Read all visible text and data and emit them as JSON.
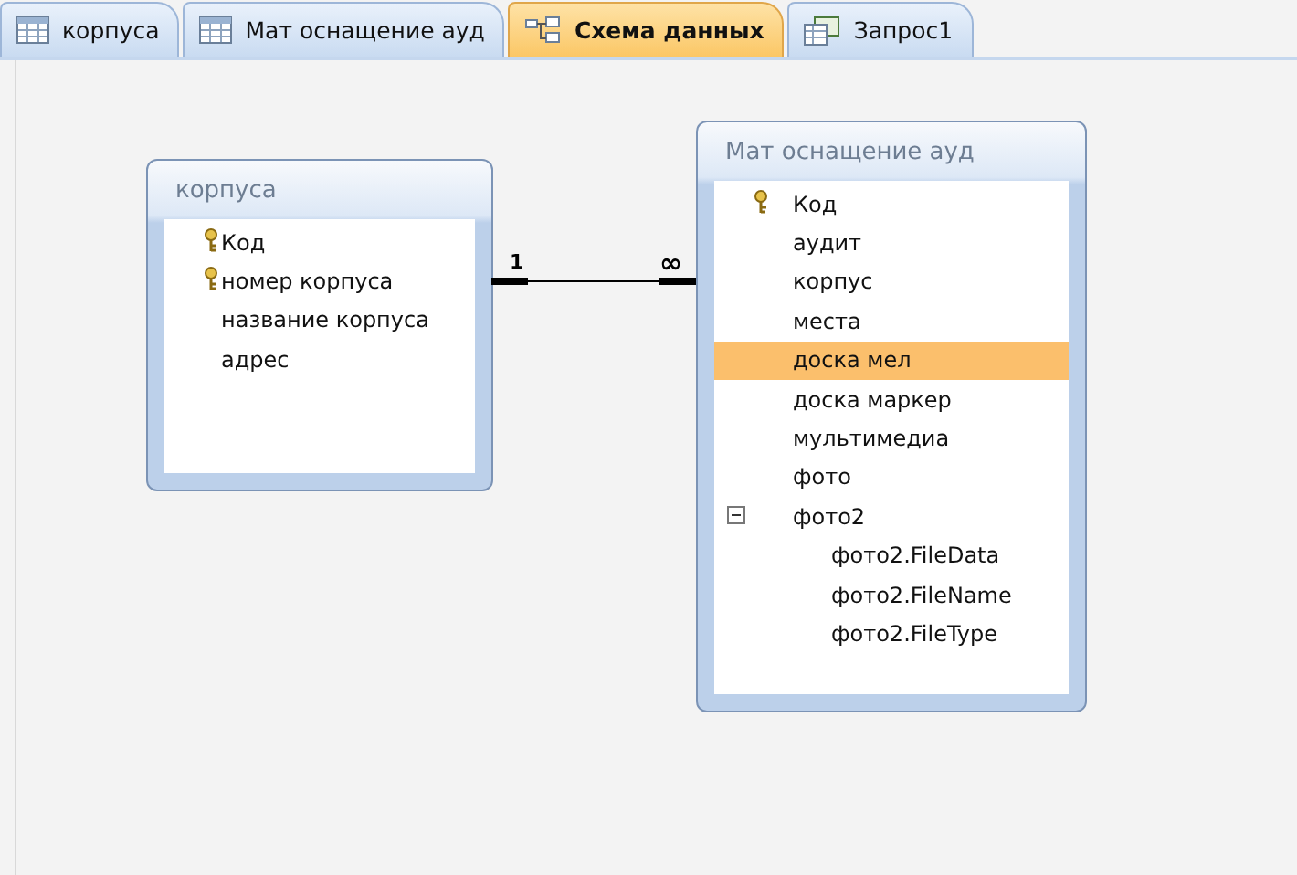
{
  "tabs": [
    {
      "label": "корпуса",
      "kind": "table",
      "selected": false
    },
    {
      "label": "Мат оснащение ауд",
      "kind": "table",
      "selected": false
    },
    {
      "label": "Схема данных",
      "kind": "relationships",
      "selected": true
    },
    {
      "label": "Запрос1",
      "kind": "query",
      "selected": false
    }
  ],
  "tables": [
    {
      "title": "корпуса",
      "fields": [
        {
          "name": "Код",
          "key": true,
          "selected": false
        },
        {
          "name": "номер корпуса",
          "key": true,
          "selected": false
        },
        {
          "name": "название корпуса",
          "key": false,
          "selected": false
        },
        {
          "name": "адрес",
          "key": false,
          "selected": false
        }
      ]
    },
    {
      "title": "Мат оснащение ауд",
      "fields": [
        {
          "name": "Код",
          "key": true,
          "selected": false
        },
        {
          "name": "аудит",
          "key": false,
          "selected": false
        },
        {
          "name": "корпус",
          "key": false,
          "selected": false
        },
        {
          "name": "места",
          "key": false,
          "selected": false
        },
        {
          "name": "доска мел",
          "key": false,
          "selected": true
        },
        {
          "name": "доска маркер",
          "key": false,
          "selected": false
        },
        {
          "name": "мультимедиа",
          "key": false,
          "selected": false
        },
        {
          "name": "фото",
          "key": false,
          "selected": false
        },
        {
          "name": "фото2",
          "key": false,
          "selected": false,
          "expanded": true,
          "children": [
            {
              "name": "фото2.FileData",
              "key": false,
              "selected": false
            },
            {
              "name": "фото2.FileName",
              "key": false,
              "selected": false
            },
            {
              "name": "фото2.FileType",
              "key": false,
              "selected": false
            }
          ]
        }
      ]
    }
  ],
  "relationship": {
    "one_label": "1",
    "many_label": "∞"
  }
}
